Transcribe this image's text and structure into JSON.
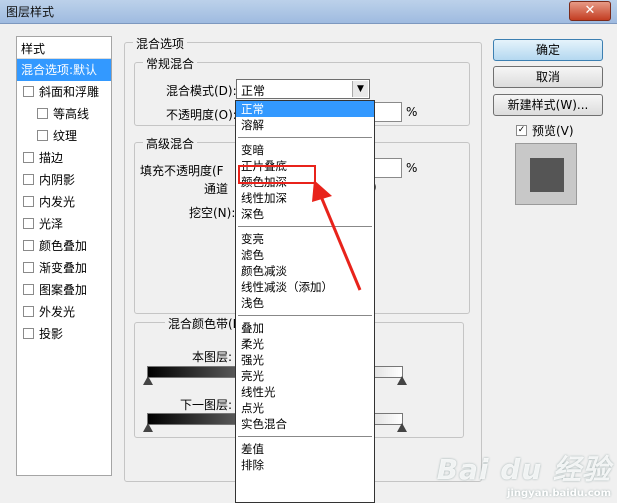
{
  "window": {
    "title": "图层样式",
    "close": "✕"
  },
  "sidebar": {
    "header": "样式",
    "items": [
      {
        "label": "混合选项:默认",
        "checkbox": false,
        "selected": true,
        "sub": false
      },
      {
        "label": "斜面和浮雕",
        "checkbox": true,
        "selected": false,
        "sub": false
      },
      {
        "label": "等高线",
        "checkbox": true,
        "selected": false,
        "sub": true
      },
      {
        "label": "纹理",
        "checkbox": true,
        "selected": false,
        "sub": true
      },
      {
        "label": "描边",
        "checkbox": true,
        "selected": false,
        "sub": false
      },
      {
        "label": "内阴影",
        "checkbox": true,
        "selected": false,
        "sub": false
      },
      {
        "label": "内发光",
        "checkbox": true,
        "selected": false,
        "sub": false
      },
      {
        "label": "光泽",
        "checkbox": true,
        "selected": false,
        "sub": false
      },
      {
        "label": "颜色叠加",
        "checkbox": true,
        "selected": false,
        "sub": false
      },
      {
        "label": "渐变叠加",
        "checkbox": true,
        "selected": false,
        "sub": false
      },
      {
        "label": "图案叠加",
        "checkbox": true,
        "selected": false,
        "sub": false
      },
      {
        "label": "外发光",
        "checkbox": true,
        "selected": false,
        "sub": false
      },
      {
        "label": "投影",
        "checkbox": true,
        "selected": false,
        "sub": false
      }
    ]
  },
  "blend_options": {
    "title": "混合选项",
    "general": {
      "title": "常规混合",
      "mode_label": "混合模式(D):",
      "mode_value": "正常",
      "opacity_label": "不透明度(O):",
      "opacity_unit": "%"
    },
    "advanced": {
      "title": "高级混合",
      "fill_label": "填充不透明度(F",
      "fill_unit": "%",
      "channels_label": "通道",
      "channels_tail": ")",
      "knockout_label": "挖空(N):"
    },
    "blend_if": {
      "title": "混合颜色带(E",
      "this_layer": "本图层:",
      "underlying": "下一图层:"
    }
  },
  "dropdown": {
    "groups": [
      [
        "正常",
        "溶解"
      ],
      [
        "变暗",
        "正片叠底",
        "颜色加深",
        "线性加深",
        "深色"
      ],
      [
        "变亮",
        "滤色",
        "颜色减淡",
        "线性减淡（添加）",
        "浅色"
      ],
      [
        "叠加",
        "柔光",
        "强光",
        "亮光",
        "线性光",
        "点光",
        "实色混合"
      ],
      [
        "差值",
        "排除"
      ]
    ],
    "highlighted": "正常"
  },
  "buttons": {
    "ok": "确定",
    "cancel": "取消",
    "new_style": "新建样式(W)...",
    "preview": "预览(V)"
  },
  "colors": {
    "highlight": "#3399ff",
    "annotation": "#e8231b"
  },
  "watermark": {
    "main": "Bai du 经验",
    "sub": "jingyan.baidu.com"
  }
}
